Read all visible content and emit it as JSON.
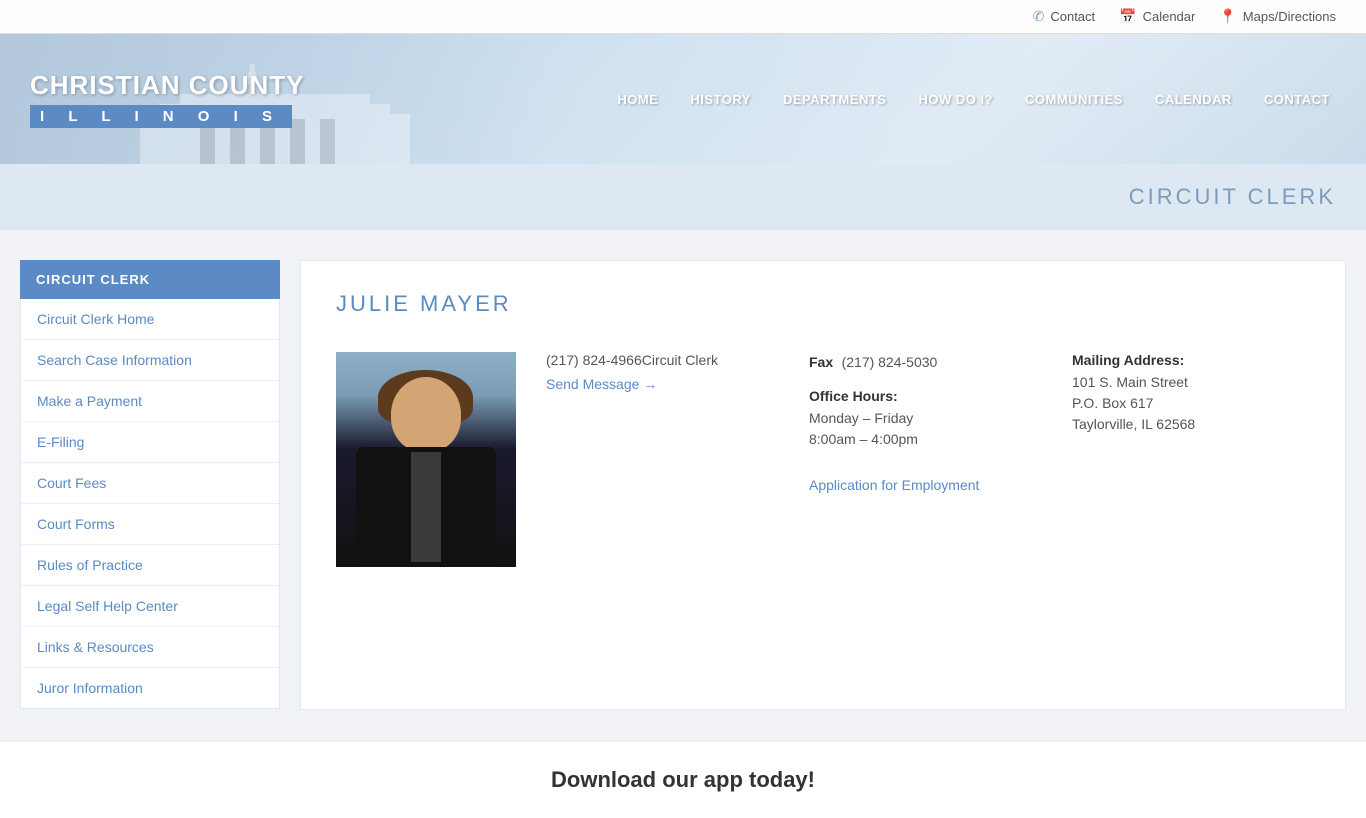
{
  "topbar": {
    "contact_label": "Contact",
    "calendar_label": "Calendar",
    "maps_label": "Maps/Directions"
  },
  "header": {
    "county_name": "CHRISTIAN COUNTY",
    "state_name": "I  L  L  I  N  O  I  S",
    "nav_items": [
      {
        "label": "HOME",
        "id": "home"
      },
      {
        "label": "HISTORY",
        "id": "history"
      },
      {
        "label": "DEPARTMENTS",
        "id": "departments"
      },
      {
        "label": "HOW DO I?",
        "id": "how-do-i"
      },
      {
        "label": "COMMUNITIES",
        "id": "communities"
      },
      {
        "label": "CALENDAR",
        "id": "calendar"
      },
      {
        "label": "CONTACT",
        "id": "contact"
      }
    ]
  },
  "page_title": "CIRCUIT CLERK",
  "sidebar": {
    "header": "CIRCUIT CLERK",
    "items": [
      {
        "label": "Circuit Clerk Home",
        "id": "circuit-clerk-home"
      },
      {
        "label": "Search Case Information",
        "id": "search-case"
      },
      {
        "label": "Make a Payment",
        "id": "make-payment"
      },
      {
        "label": "E-Filing",
        "id": "e-filing"
      },
      {
        "label": "Court Fees",
        "id": "court-fees"
      },
      {
        "label": "Court Forms",
        "id": "court-forms"
      },
      {
        "label": "Rules of Practice",
        "id": "rules-practice"
      },
      {
        "label": "Legal Self Help Center",
        "id": "legal-self-help"
      },
      {
        "label": "Links & Resources",
        "id": "links-resources"
      },
      {
        "label": "Juror Information",
        "id": "juror-info"
      }
    ]
  },
  "content": {
    "person_name": "JULIE MAYER",
    "phone": "(217) 824-4966",
    "phone_label": "Circuit Clerk",
    "fax_label": "Fax",
    "fax": "(217) 824-5030",
    "send_message": "Send Message →",
    "office_hours_label": "Office Hours:",
    "office_days": "Monday – Friday",
    "office_time": "8:00am – 4:00pm",
    "mailing_label": "Mailing Address:",
    "address_line1": "101 S. Main Street",
    "address_line2": "P.O. Box 617",
    "address_line3": "Taylorville, IL 62568",
    "app_link": "Application for Employment"
  },
  "bottom_banner": {
    "text": "Download our app today!"
  }
}
